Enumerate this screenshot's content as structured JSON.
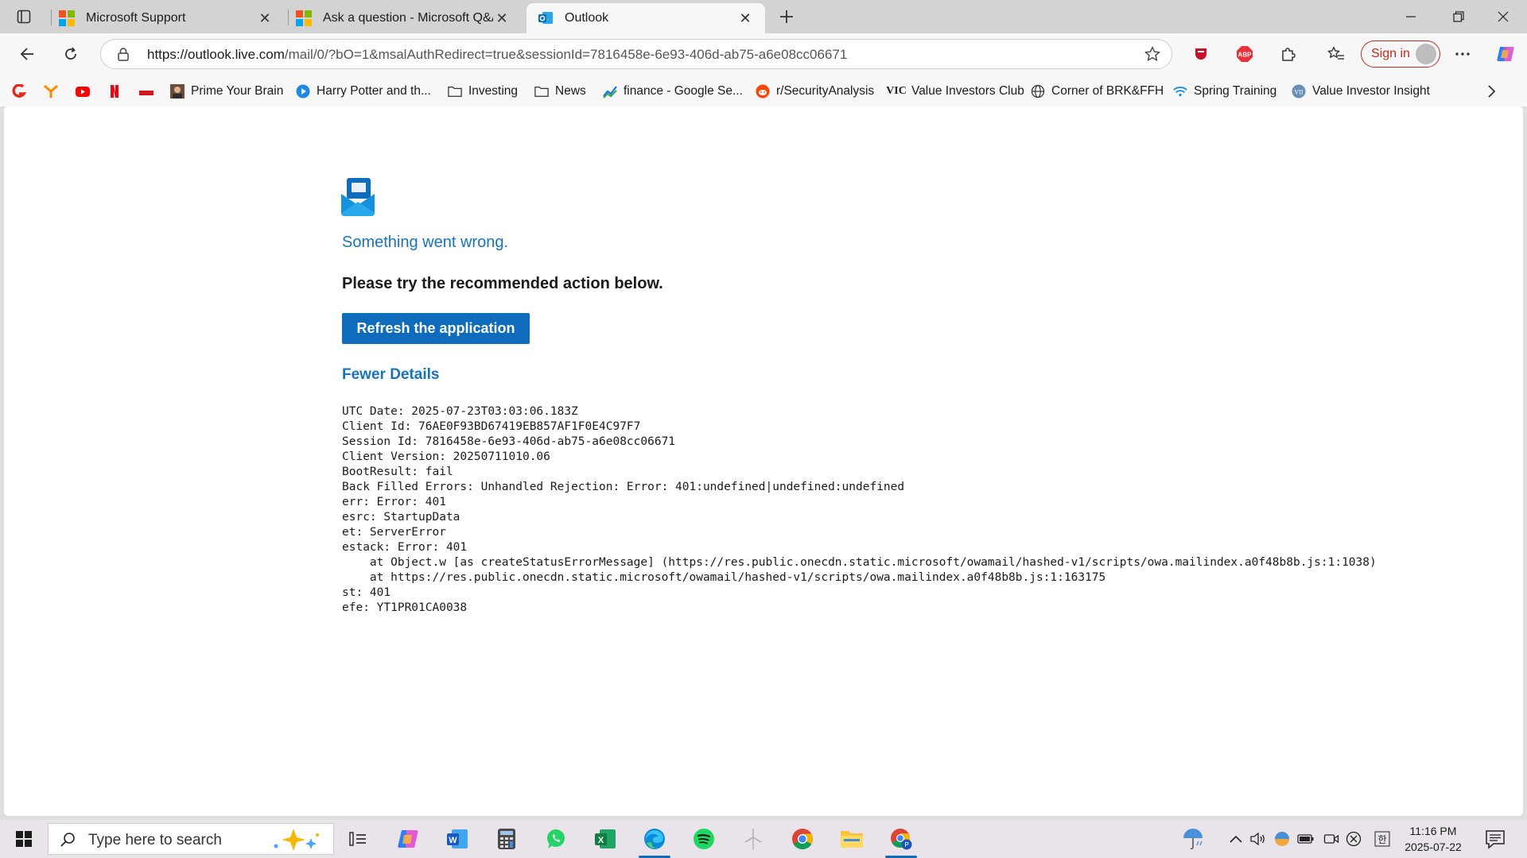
{
  "tabs": [
    {
      "title": "Microsoft Support"
    },
    {
      "title": "Ask a question - Microsoft Q&A"
    },
    {
      "title": "Outlook"
    }
  ],
  "address_bar": {
    "url_host": "https://outlook.live.com",
    "url_path": "/mail/0/?bO=1&msalAuthRedirect=true&sessionId=7816458e-6e93-406d-ab75-a6e08cc06671"
  },
  "toolbar": {
    "signin_label": "Sign in"
  },
  "bookmarks": [
    {
      "label": "Prime Your Brain"
    },
    {
      "label": "Harry Potter and th..."
    },
    {
      "label": "Investing"
    },
    {
      "label": "News"
    },
    {
      "label": "finance - Google Se..."
    },
    {
      "label": "r/SecurityAnalysis"
    },
    {
      "label": "Value Investors Club"
    },
    {
      "label": "Corner of BRK&FFH"
    },
    {
      "label": "Spring Training"
    },
    {
      "label": "Value Investor Insight"
    }
  ],
  "page": {
    "error_title": "Something went wrong.",
    "error_subtitle": "Please try the recommended action below.",
    "refresh_label": "Refresh the application",
    "fewer_details_label": "Fewer Details",
    "details": [
      "UTC Date: 2025-07-23T03:03:06.183Z",
      "Client Id: 76AE0F93BD67419EB857AF1F0E4C97F7",
      "Session Id: 7816458e-6e93-406d-ab75-a6e08cc06671",
      "Client Version: 20250711010.06",
      "BootResult: fail",
      "Back Filled Errors: Unhandled Rejection: Error: 401:undefined|undefined:undefined",
      "err: Error: 401",
      "esrc: StartupData",
      "et: ServerError",
      "estack: Error: 401",
      "    at Object.w [as createStatusErrorMessage] (https://res.public.onecdn.static.microsoft/owamail/hashed-v1/scripts/owa.mailindex.a0f48b8b.js:1:1038)",
      "    at https://res.public.onecdn.static.microsoft/owamail/hashed-v1/scripts/owa.mailindex.a0f48b8b.js:1:163175",
      "st: 401",
      "efe: YT1PR01CA0038"
    ]
  },
  "taskbar": {
    "search_placeholder": "Type here to search",
    "time": "11:16 PM",
    "date": "2025-07-22"
  },
  "colors": {
    "accent_blue": "#0f6cbd",
    "link_blue": "#1a73b8",
    "signin_red": "#c42b1c"
  }
}
